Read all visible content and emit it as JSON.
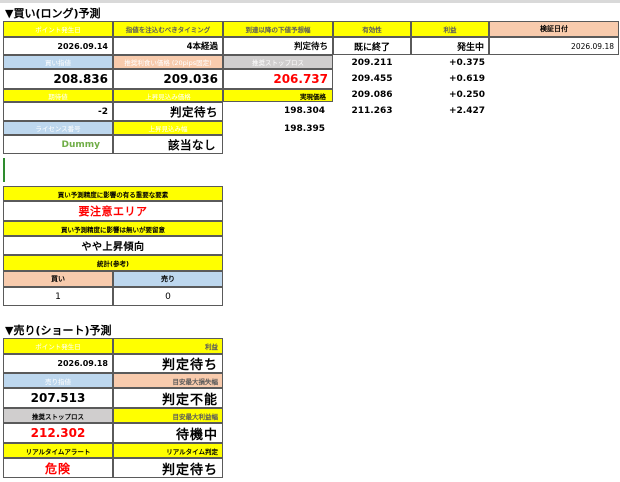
{
  "long": {
    "title": "▼買い(ロング)予測",
    "headers": {
      "point_date": "ポイント発生日",
      "timing": "指値を注込むべきタイミング",
      "lower_limit": "到達以降の下値予想幅",
      "valid": "有効性",
      "profit": "利益",
      "check_date": "検証日付"
    },
    "point_date": "2026.09.14",
    "timing": "4本経過",
    "lower_limit": "判定待ち",
    "valid": "既に終了",
    "profit_status": "発生中",
    "check_date": "2026.09.18",
    "buy_limit_label": "買い指値",
    "recommend_label": "推奨利食い価格 (20pips固定)",
    "stop_label": "推奨ストップロス",
    "buy_limit": "208.836",
    "recommend": "209.036",
    "stop": "206.737",
    "expect_label": "期待値",
    "upper_label": "上昇見込み価格",
    "actual_label": "実現価格",
    "expect": "-2",
    "upper": "判定待ち",
    "license_label": "ライセンス番号",
    "upper2_label": "上昇見込み幅",
    "license": "Dummy",
    "upper2": "該当なし",
    "prices": [
      {
        "price": "209.211",
        "diff": "+0.375"
      },
      {
        "price": "209.455",
        "diff": "+0.619"
      },
      {
        "price": "209.086",
        "diff": "+0.250"
      },
      {
        "price": "211.263",
        "diff": "+2.427"
      }
    ],
    "actual_prices": [
      "198.304",
      "198.395"
    ]
  },
  "impact": {
    "title1": "買い予測精度に影響の有る重要な要素",
    "value1": "要注意エリア",
    "title2": "買い予測精度に影響は無いが要留意",
    "value2": "やや上昇傾向",
    "stats_title": "統計(参考)",
    "buy_label": "買い",
    "sell_label": "売り",
    "buy_count": "1",
    "sell_count": "0"
  },
  "short": {
    "title": "▼売り(ショート)予測",
    "point_date_label": "ポイント発生日",
    "profit_label": "利益",
    "point_date": "2026.09.18",
    "profit": "判定待ち",
    "sell_limit_label": "売り指値",
    "loss_range_label": "目安最大損失幅",
    "sell_limit": "207.513",
    "loss_range": "判定不能",
    "stop_label": "推奨ストップロス",
    "profit_range_label": "目安最大利益幅",
    "stop": "212.302",
    "profit_range": "待機中",
    "alert_label": "リアルタイムアラート",
    "judge_label": "リアルタイム判定",
    "alert": "危険",
    "judge": "判定待ち"
  }
}
